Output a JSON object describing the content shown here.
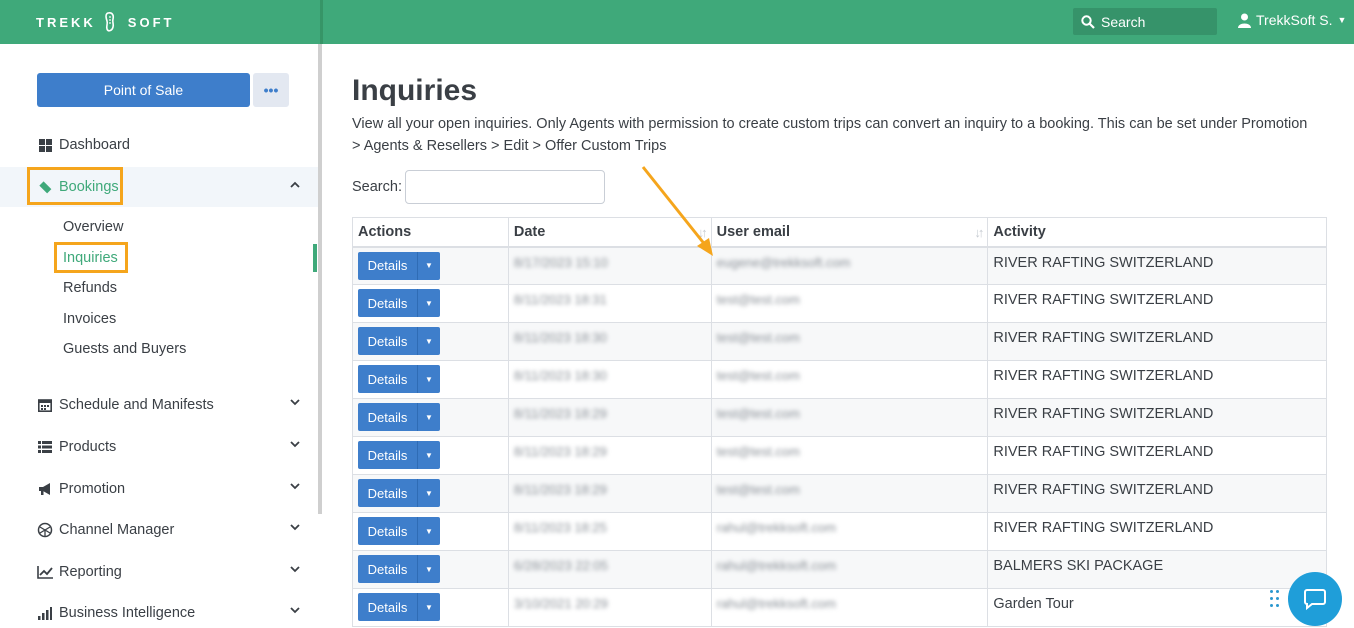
{
  "header": {
    "logo_left": "TREKK",
    "logo_right": "SOFT",
    "search_label": "Search",
    "user_name": "TrekkSoft S."
  },
  "sidebar": {
    "pos_label": "Point of Sale",
    "more_label": "•••",
    "items": [
      {
        "label": "Dashboard",
        "icon": "dashboard-icon"
      },
      {
        "label": "Bookings",
        "icon": "ticket-icon"
      },
      {
        "label": "Schedule and Manifests",
        "icon": "calendar-icon"
      },
      {
        "label": "Products",
        "icon": "list-icon"
      },
      {
        "label": "Promotion",
        "icon": "megaphone-icon"
      },
      {
        "label": "Channel Manager",
        "icon": "network-icon"
      },
      {
        "label": "Reporting",
        "icon": "line-chart-icon"
      },
      {
        "label": "Business Intelligence",
        "icon": "bar-chart-icon"
      }
    ],
    "bookings_sub": [
      "Overview",
      "Inquiries",
      "Refunds",
      "Invoices",
      "Guests and Buyers"
    ]
  },
  "main": {
    "title": "Inquiries",
    "description": "View all your open inquiries. Only Agents with permission to create custom trips can convert an inquiry to a booking. This can be set under Promotion > Agents & Resellers > Edit > Offer Custom Trips",
    "search_label": "Search:",
    "columns": [
      "Actions",
      "Date",
      "User email",
      "Activity"
    ],
    "details_label": "Details",
    "rows": [
      {
        "date": "8/17/2023 15:10",
        "email": "eugene@trekksoft.com",
        "activity": "RIVER RAFTING SWITZERLAND"
      },
      {
        "date": "8/11/2023 18:31",
        "email": "test@test.com",
        "activity": "RIVER RAFTING SWITZERLAND"
      },
      {
        "date": "8/11/2023 18:30",
        "email": "test@test.com",
        "activity": "RIVER RAFTING SWITZERLAND"
      },
      {
        "date": "8/11/2023 18:30",
        "email": "test@test.com",
        "activity": "RIVER RAFTING SWITZERLAND"
      },
      {
        "date": "8/11/2023 18:29",
        "email": "test@test.com",
        "activity": "RIVER RAFTING SWITZERLAND"
      },
      {
        "date": "8/11/2023 18:29",
        "email": "test@test.com",
        "activity": "RIVER RAFTING SWITZERLAND"
      },
      {
        "date": "8/11/2023 18:29",
        "email": "test@test.com",
        "activity": "RIVER RAFTING SWITZERLAND"
      },
      {
        "date": "8/11/2023 18:25",
        "email": "rahul@trekksoft.com",
        "activity": "RIVER RAFTING SWITZERLAND"
      },
      {
        "date": "6/28/2023 22:05",
        "email": "rahul@trekksoft.com",
        "activity": "BALMERS SKI PACKAGE"
      },
      {
        "date": "3/10/2021 20:29",
        "email": "rahul@trekksoft.com",
        "activity": "Garden Tour"
      }
    ]
  },
  "colors": {
    "brand_green": "#3fa97a",
    "button_blue": "#3e7ecb",
    "highlight_orange": "#f5a51c",
    "chat_blue": "#1f9ed9"
  }
}
